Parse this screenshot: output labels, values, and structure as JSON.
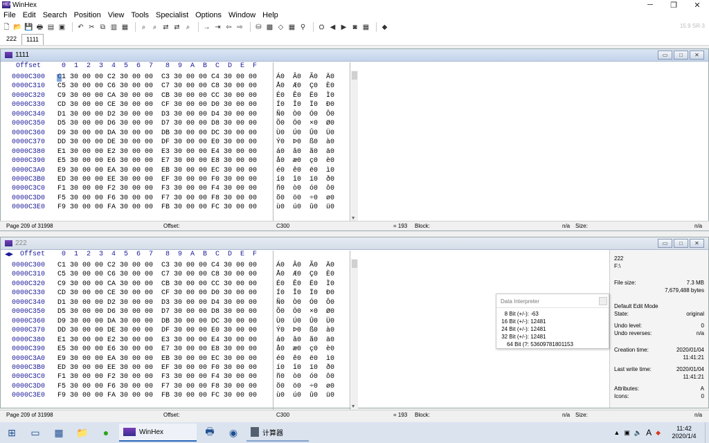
{
  "app": {
    "title": "WinHex",
    "version": "15.9 SR-3"
  },
  "window_controls": [
    "─",
    "❐",
    "✕"
  ],
  "menu": [
    "File",
    "Edit",
    "Search",
    "Position",
    "View",
    "Tools",
    "Specialist",
    "Options",
    "Window",
    "Help"
  ],
  "toolbar_icons": [
    "new-icon",
    "open-icon",
    "save-icon",
    "print-icon",
    "properties-icon",
    "open-folder-icon",
    "undo-icon",
    "cut-icon",
    "copy-icon",
    "paste-icon",
    "write-icon",
    "find-icon",
    "find-hex-icon",
    "replace-icon",
    "replace-hex-icon",
    "find-next-icon",
    "goto-offset-icon",
    "goto-page-icon",
    "back-icon",
    "forward-icon",
    "disk-icon",
    "ram-icon",
    "erase-icon",
    "calculator-icon",
    "search-icon",
    "disk-editor-icon",
    "prev-icon",
    "next-icon",
    "snapshot-icon",
    "table-icon",
    "help-icon"
  ],
  "tabs": [
    "222",
    "1111"
  ],
  "hex_header": {
    "offset_label": "Offset",
    "columns": "0  1  2  3  4  5  6  7   8  9  A  B  C  D  E  F"
  },
  "rows": [
    {
      "offset": "0000C300",
      "hex": "C1 30 00 00 C2 30 00 00  C3 30 00 00 C4 30 00 00",
      "text": "Á0  Â0  Ã0  Ä0"
    },
    {
      "offset": "0000C310",
      "hex": "C5 30 00 00 C6 30 00 00  C7 30 00 00 C8 30 00 00",
      "text": "Å0  Æ0  Ç0  È0"
    },
    {
      "offset": "0000C320",
      "hex": "C9 30 00 00 CA 30 00 00  CB 30 00 00 CC 30 00 00",
      "text": "É0  Ê0  Ë0  Ì0"
    },
    {
      "offset": "0000C330",
      "hex": "CD 30 00 00 CE 30 00 00  CF 30 00 00 D0 30 00 00",
      "text": "Í0  Î0  Ï0  Ð0"
    },
    {
      "offset": "0000C340",
      "hex": "D1 30 00 00 D2 30 00 00  D3 30 00 00 D4 30 00 00",
      "text": "Ñ0  Ò0  Ó0  Ô0"
    },
    {
      "offset": "0000C350",
      "hex": "D5 30 00 00 D6 30 00 00  D7 30 00 00 D8 30 00 00",
      "text": "Õ0  Ö0  ×0  Ø0"
    },
    {
      "offset": "0000C360",
      "hex": "D9 30 00 00 DA 30 00 00  DB 30 00 00 DC 30 00 00",
      "text": "Ù0  Ú0  Û0  Ü0"
    },
    {
      "offset": "0000C370",
      "hex": "DD 30 00 00 DE 30 00 00  DF 30 00 00 E0 30 00 00",
      "text": "Ý0  Þ0  ß0  à0"
    },
    {
      "offset": "0000C380",
      "hex": "E1 30 00 00 E2 30 00 00  E3 30 00 00 E4 30 00 00",
      "text": "á0  â0  ã0  ä0"
    },
    {
      "offset": "0000C390",
      "hex": "E5 30 00 00 E6 30 00 00  E7 30 00 00 E8 30 00 00",
      "text": "å0  æ0  ç0  è0"
    },
    {
      "offset": "0000C3A0",
      "hex": "E9 30 00 00 EA 30 00 00  EB 30 00 00 EC 30 00 00",
      "text": "é0  ê0  ë0  ì0"
    },
    {
      "offset": "0000C3B0",
      "hex": "ED 30 00 00 EE 30 00 00  EF 30 00 00 F0 30 00 00",
      "text": "í0  î0  ï0  ð0"
    },
    {
      "offset": "0000C3C0",
      "hex": "F1 30 00 00 F2 30 00 00  F3 30 00 00 F4 30 00 00",
      "text": "ñ0  ò0  ó0  ô0"
    },
    {
      "offset": "0000C3D0",
      "hex": "F5 30 00 00 F6 30 00 00  F7 30 00 00 F8 30 00 00",
      "text": "õ0  ö0  ÷0  ø0"
    },
    {
      "offset": "0000C3E0",
      "hex": "F9 30 00 00 FA 30 00 00  FB 30 00 00 FC 30 00 00",
      "text": "ù0  ú0  û0  ü0"
    }
  ],
  "top_window": {
    "title": "1111",
    "status": {
      "page": "Page 209 of 31998",
      "offset_label": "Offset:",
      "offset_value": "C300",
      "value": "= 193",
      "block_label": "Block:",
      "block_value": "n/a",
      "size_label": "Size:",
      "size_value": "n/a"
    }
  },
  "bottom_window": {
    "title": "222",
    "status": {
      "page": "Page 209 of 31998",
      "offset_label": "Offset:",
      "offset_value": "C300",
      "value": "= 193",
      "block_label": "Block:",
      "block_value": "n/a",
      "size_label": "Size:",
      "size_value": "n/a"
    }
  },
  "info_panel": {
    "name": "222",
    "path": "F:\\",
    "file_size_label": "File size:",
    "file_size_mb": "7.3 MB",
    "file_size_bytes": "7,679,488 bytes",
    "edit_mode": "Default Edit Mode",
    "state_label": "State:",
    "state_value": "original",
    "undo_level_label": "Undo level:",
    "undo_level_value": "0",
    "undo_reverses_label": "Undo reverses:",
    "undo_reverses_value": "n/a",
    "creation_label": "Creation time:",
    "creation_date": "2020/01/04",
    "creation_time": "11:41:21",
    "lastwrite_label": "Last write time:",
    "lastwrite_date": "2020/01/04",
    "lastwrite_time": "11:41:21",
    "attributes_label": "Attributes:",
    "attributes_value": "A",
    "icons_label": "Icons:",
    "icons_value": "0"
  },
  "data_interpreter": {
    "title": "Data Interpreter",
    "rows": [
      {
        "label": "8 Bit (+/-):",
        "value": "-63"
      },
      {
        "label": "16 Bit (+/-):",
        "value": "12481"
      },
      {
        "label": "24 Bit (+/-):",
        "value": "12481"
      },
      {
        "label": "32 Bit (+/-):",
        "value": "12481"
      },
      {
        "label": "64 Bit (?:",
        "value": "53609781801153"
      }
    ]
  },
  "taskbar": {
    "apps": [
      {
        "label": "WinHex",
        "active": true
      },
      {
        "label": "计算器",
        "active": false
      }
    ],
    "tray_lang": "A",
    "time": "11:42",
    "date": "2020/1/4"
  }
}
